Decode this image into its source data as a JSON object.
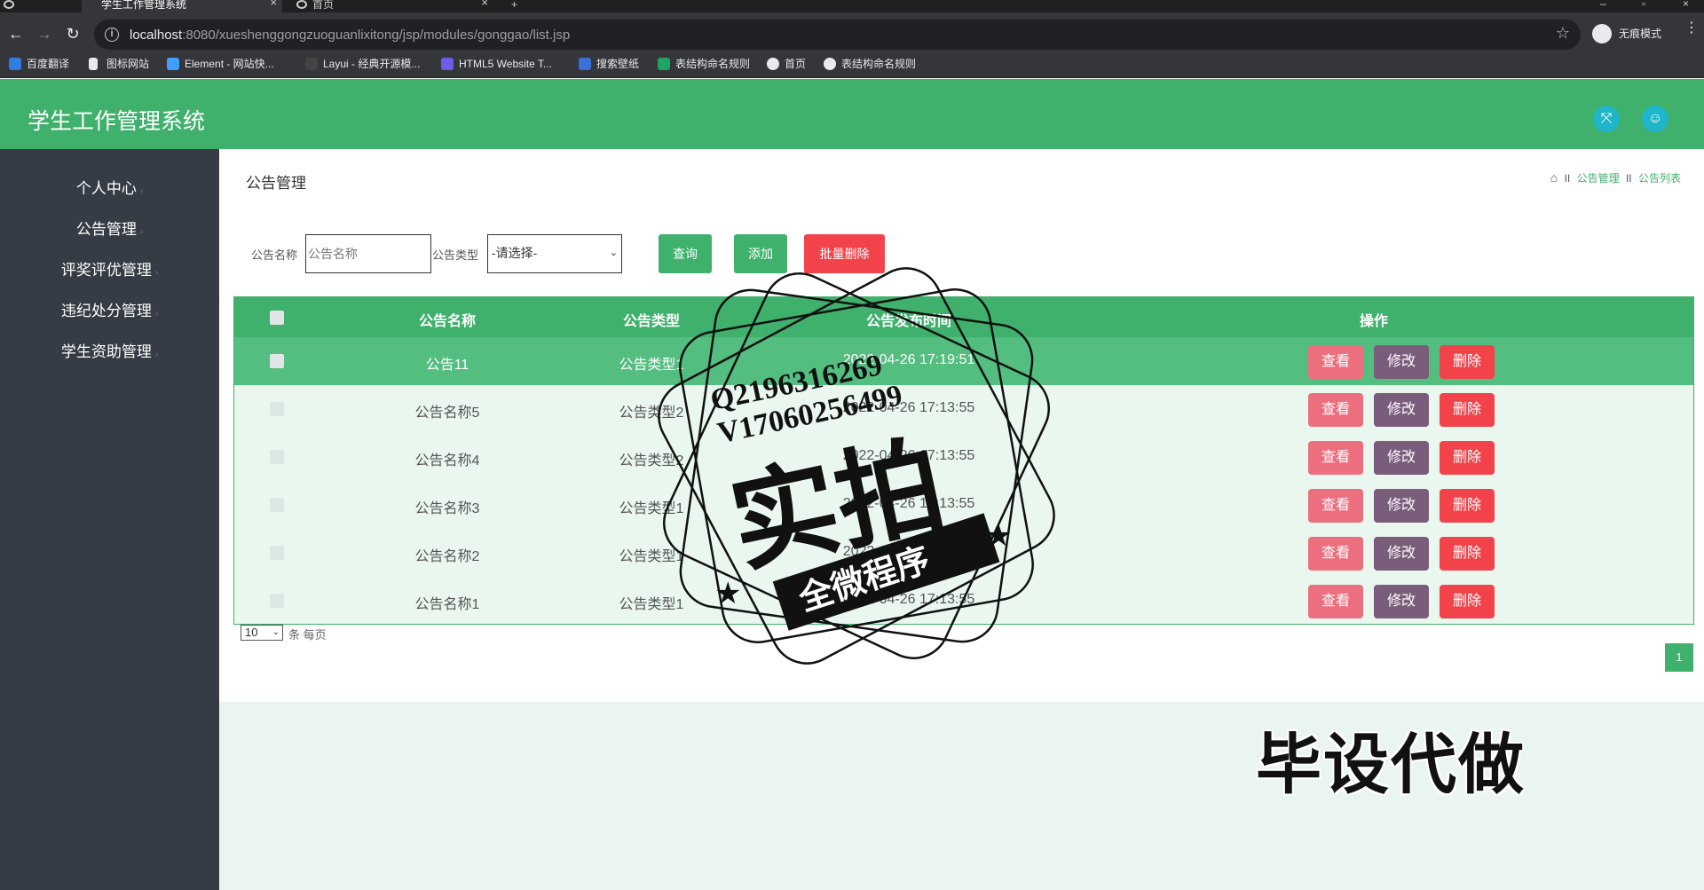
{
  "browser": {
    "tabs": [
      {
        "label": "学生工作管理系统"
      },
      {
        "label": "首页"
      }
    ],
    "new_tab": "+",
    "url_host": "localhost",
    "url_rest": ":8080/xueshenggongzuoguanlixitong/jsp/modules/gonggao/list.jsp",
    "incognito_label": "无痕模式",
    "bookmarks": [
      {
        "label": "百度翻译"
      },
      {
        "label": "图标网站"
      },
      {
        "label": "Element - 网站快..."
      },
      {
        "label": "Layui - 经典开源模..."
      },
      {
        "label": "HTML5 Website T..."
      },
      {
        "label": "搜索壁纸"
      },
      {
        "label": "表结构命名规则"
      },
      {
        "label": "首页"
      },
      {
        "label": "表结构命名规则"
      }
    ]
  },
  "app": {
    "title": "学生工作管理系统"
  },
  "sidebar": {
    "items": [
      {
        "label": "个人中心"
      },
      {
        "label": "公告管理"
      },
      {
        "label": "评奖评优管理"
      },
      {
        "label": "违纪处分管理"
      },
      {
        "label": "学生资助管理"
      }
    ]
  },
  "main": {
    "page_title": "公告管理",
    "breadcrumb": [
      "公告管理",
      "公告列表"
    ],
    "breadcrumb_sep": "II",
    "filters": {
      "name_label": "公告名称",
      "name_placeholder": "公告名称",
      "type_label": "公告类型",
      "type_selected": "-请选择-"
    },
    "buttons": {
      "search": "查询",
      "add": "添加",
      "batch_delete": "批量删除"
    },
    "table": {
      "headers": [
        "公告名称",
        "公告类型",
        "公告发布时间",
        "操作"
      ],
      "rows": [
        {
          "name": "公告11",
          "type": "公告类型1",
          "time": "2022-04-26 17:19:51"
        },
        {
          "name": "公告名称5",
          "type": "公告类型2",
          "time": "2022-04-26 17:13:55"
        },
        {
          "name": "公告名称4",
          "type": "公告类型2",
          "time": "2022-04-26 17:13:55"
        },
        {
          "name": "公告名称3",
          "type": "公告类型1",
          "time": "2022-04-26 17:13:55"
        },
        {
          "name": "公告名称2",
          "type": "公告类型1",
          "time": "2022-04-26 17:13:55"
        },
        {
          "name": "公告名称1",
          "type": "公告类型1",
          "time": "2022-04-26 17:13:55"
        }
      ],
      "actions": {
        "view": "查看",
        "edit": "修改",
        "delete": "删除"
      }
    },
    "pagination": {
      "page_size": "10",
      "page_size_label": "条 每页",
      "current_page": "1"
    }
  },
  "overlay": {
    "stamp_lines": [
      "Q2196316269",
      "V17060256499",
      "实拍",
      "全微程序"
    ],
    "bottom_text": "毕设代做"
  },
  "colors": {
    "brand_green": "#3fb16c",
    "sidebar_bg": "#353c45",
    "view_btn": "#ec6f7f",
    "edit_btn": "#7a5d7a",
    "delete_btn": "#f2434b",
    "batch_delete": "#f2434b",
    "header_icon": "#1fb6c9"
  }
}
